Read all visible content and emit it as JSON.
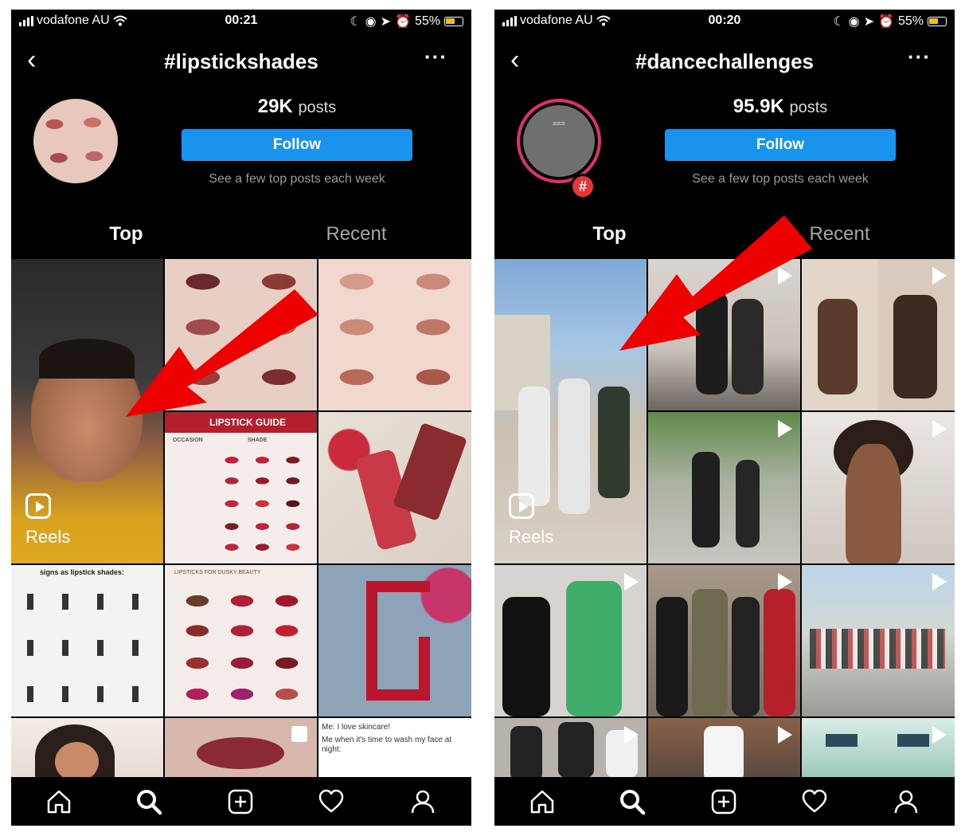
{
  "status_left": {
    "carrier": "vodafone AU",
    "time": "00:21",
    "battery": "55%"
  },
  "status_right": {
    "carrier": "vodafone AU",
    "time": "00:20",
    "battery": "55%"
  },
  "left": {
    "title": "#lipstickshades",
    "posts_count": "29K",
    "posts_label": "posts",
    "follow_label": "Follow",
    "subtext": "See a few top posts each week",
    "tabs": [
      "Top",
      "Recent"
    ],
    "reels_label": "Reels",
    "thumb_texts": {
      "guide": "LIPSTICK GUIDE",
      "occasion": "OCCASION",
      "shade": "SHADE",
      "signs": "signs as lipstick shades:",
      "dusky": "LIPSTICKS FOR DUSKY BEAUTY",
      "meme1": "Me: I love skincare!",
      "meme2": "Me when it's time to wash my face at night:"
    }
  },
  "right": {
    "title": "#dancechallenges",
    "posts_count": "95.9K",
    "posts_label": "posts",
    "follow_label": "Follow",
    "subtext": "See a few top posts each week",
    "tabs": [
      "Top",
      "Recent"
    ],
    "reels_label": "Reels",
    "badge": "#"
  },
  "icons": [
    "home-icon",
    "search-icon",
    "new-post-icon",
    "activity-heart-icon",
    "profile-icon"
  ],
  "colors": {
    "follow": "#1a93ee",
    "arrow": "#ee0000",
    "background": "#000000"
  }
}
